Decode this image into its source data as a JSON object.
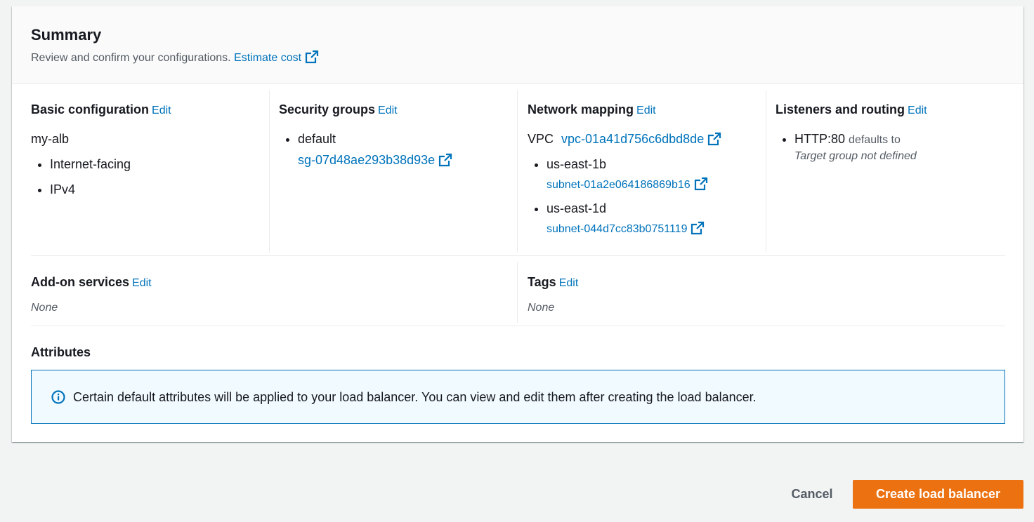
{
  "summary": {
    "title": "Summary",
    "description": "Review and confirm your configurations.",
    "estimate_cost_link": "Estimate cost"
  },
  "edit_label": "Edit",
  "basic_configuration": {
    "title": "Basic configuration",
    "name": "my-alb",
    "items": [
      "Internet-facing",
      "IPv4"
    ]
  },
  "security_groups": {
    "title": "Security groups",
    "group_name": "default",
    "group_id": "sg-07d48ae293b38d93e"
  },
  "network_mapping": {
    "title": "Network mapping",
    "vpc_label": "VPC",
    "vpc_id": "vpc-01a41d756c6dbd8de",
    "subnets": [
      {
        "zone": "us-east-1b",
        "subnet": "subnet-01a2e064186869b16"
      },
      {
        "zone": "us-east-1d",
        "subnet": "subnet-044d7cc83b0751119"
      }
    ]
  },
  "listeners": {
    "title": "Listeners and routing",
    "protocol_port": "HTTP:80",
    "defaults_to": "defaults to",
    "target": "Target group not defined"
  },
  "addon_services": {
    "title": "Add-on services",
    "value": "None"
  },
  "tags": {
    "title": "Tags",
    "value": "None"
  },
  "attributes": {
    "title": "Attributes",
    "info_text": "Certain default attributes will be applied to your load balancer. You can view and edit them after creating the load balancer."
  },
  "footer": {
    "cancel_label": "Cancel",
    "create_label": "Create load balancer"
  },
  "colors": {
    "link": "#0073bb",
    "primary_button": "#ec7211",
    "info_background": "#f1faff",
    "info_border": "#0073bb"
  },
  "icons": {
    "external_link": "external-link-icon",
    "info": "info-icon"
  }
}
